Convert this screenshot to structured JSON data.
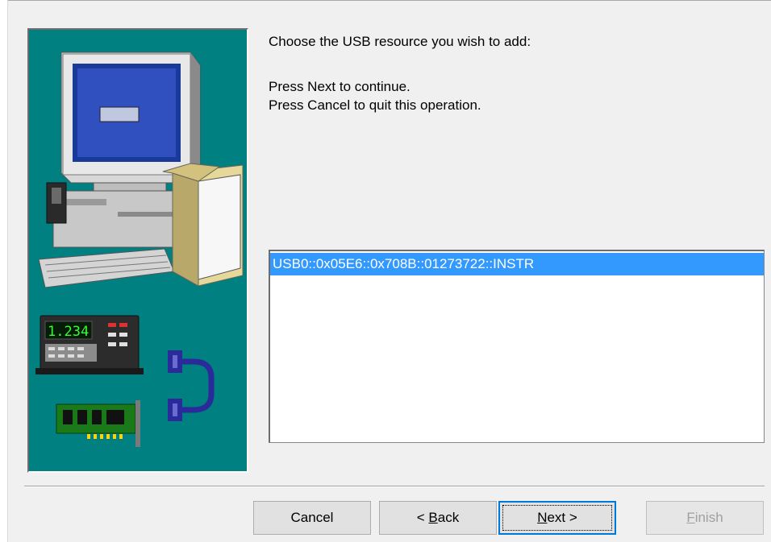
{
  "instructions": {
    "line1": "Choose the USB resource you wish to add:",
    "line2": "Press Next to continue.",
    "line3": "Press Cancel to quit this operation."
  },
  "resource_list": {
    "items": [
      "USB0::0x05E6::0x708B::01273722::INSTR"
    ],
    "selected_index": 0
  },
  "buttons": {
    "cancel": "Cancel",
    "back_prefix": "< ",
    "back_mnemonic": "B",
    "back_rest": "ack",
    "next_mnemonic": "N",
    "next_rest": "ext >",
    "finish_mnemonic": "F",
    "finish_rest": "inish"
  },
  "colors": {
    "panel_background": "#008080",
    "selection": "#3399ff",
    "default_button_border": "#0078d7",
    "disabled_text": "#a0a0a0"
  },
  "icons": [
    "computer-illustration",
    "multimeter-icon",
    "gpib-card-icon",
    "usb-connector-icon"
  ]
}
